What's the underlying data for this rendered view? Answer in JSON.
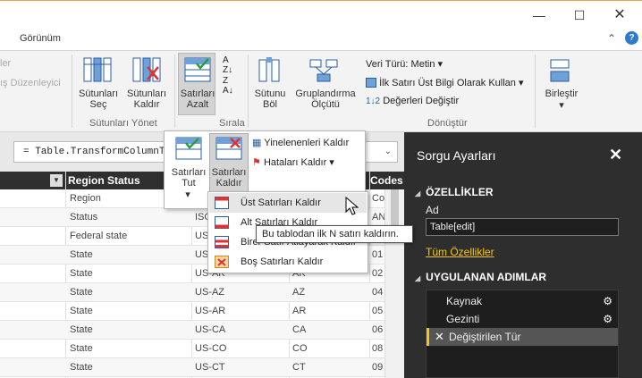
{
  "window": {
    "minimize_icon": "minimize-icon",
    "maximize_icon": "maximize-icon",
    "close_icon": "close-icon"
  },
  "menu": {
    "view_tab": "Görünüm",
    "help_glyph": "?"
  },
  "ribbon": {
    "left_partial_top": "ler",
    "left_partial_bottom": "ış Düzenleyici",
    "choose_columns": "Sütunları Seç",
    "remove_columns": "Sütunları Kaldır",
    "manage_columns_group": "Sütunları Yönet",
    "reduce_rows": "Satırları Azalt",
    "sort_group": "Sırala",
    "split_column": "Sütunu Böl",
    "group_by": "Gruplandırma Ölçütü",
    "data_type": "Veri Türü: Metin",
    "use_first_row": "İlk Satırı Üst Bilgi Olarak Kullan",
    "replace_values": "Değerleri Değiştir",
    "transform_group": "Dönüştür",
    "combine": "Birleştir"
  },
  "formula": {
    "text": "= Table.TransformColumnT"
  },
  "grid": {
    "columns": [
      "Region Status",
      "Codes"
    ],
    "rows": [
      [
        "Region",
        "",
        "",
        "Co"
      ],
      [
        "Status",
        "ISO",
        "",
        "AN"
      ],
      [
        "Federal state",
        "US",
        "",
        "00"
      ],
      [
        "State",
        "US-AL",
        "AL",
        "01"
      ],
      [
        "State",
        "US-AK",
        "AK",
        "02"
      ],
      [
        "State",
        "US-AZ",
        "AZ",
        "04"
      ],
      [
        "State",
        "US-AR",
        "AR",
        "05"
      ],
      [
        "State",
        "US-CA",
        "CA",
        "06"
      ],
      [
        "State",
        "US-CO",
        "CO",
        "08"
      ],
      [
        "State",
        "US-CT",
        "CT",
        "09"
      ]
    ]
  },
  "popup_reduce": {
    "keep_rows": "Satırları Tut",
    "remove_rows": "Satırları Kaldır",
    "remove_duplicates": "Yinelenenleri Kaldır",
    "remove_errors": "Hataları Kaldır"
  },
  "popup_remove_rows": {
    "items": [
      "Üst Satırları Kaldır",
      "Alt Satırları Kaldır",
      "Birer Satır Atlayarak Kaldır",
      "Boş Satırları Kaldır"
    ]
  },
  "tooltip": "Bu tablodan ilk N satırı kaldırın.",
  "pane": {
    "title": "Sorgu Ayarları",
    "properties_header": "ÖZELLİKLER",
    "name_label": "Ad",
    "name_value": "Table[edit]",
    "all_properties": "Tüm Özellikler",
    "applied_steps_header": "UYGULANAN ADIMLAR",
    "steps": [
      "Kaynak",
      "Gezinti",
      "Değiştirilen Tür"
    ]
  },
  "colors": {
    "accent": "#f5c518",
    "pane_bg": "#2e2e2e",
    "header_bg": "#2f2f2f",
    "help_blue": "#2b7bd3"
  }
}
